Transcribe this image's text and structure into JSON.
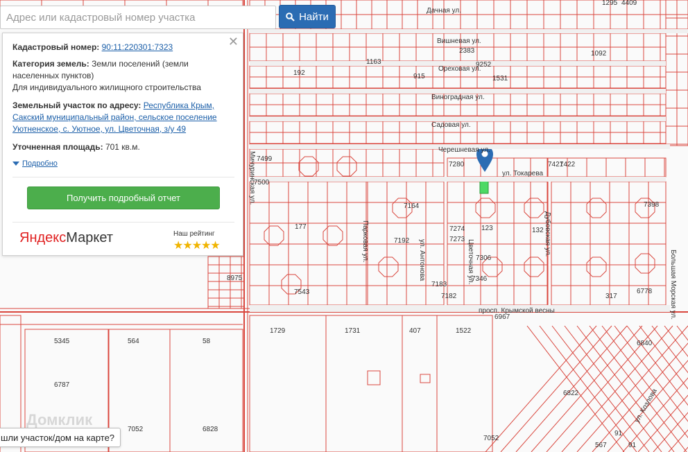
{
  "search": {
    "placeholder": "Адрес или кадастровый номер участка",
    "button_label": "Найти"
  },
  "info": {
    "cadastral_label": "Кадастровый номер:",
    "cadastral_value": "90:11:220301:7323",
    "category_label": "Категория земель:",
    "category_value_1": "Земли поселений (земли",
    "category_value_2": "населенных пунктов)",
    "category_value_3": "Для индивидуального жилищного строительства",
    "address_label": "Земельный участок по адресу:",
    "address_line_1": "Республика Крым,",
    "address_line_2": "Сакский муниципальный район, сельское поселение",
    "address_line_3": "Уютненское, с. Уютное, ул. Цветочная, з/у 49",
    "area_label": "Уточненная площадь:",
    "area_value": "701 кв.м.",
    "more_link": "Подробно",
    "report_button": "Получить подробный отчет",
    "market_brand_1": "Яндекс",
    "market_brand_2": "Маркет",
    "rating_label": "Наш рейтинг",
    "rating_stars": "★★★★★"
  },
  "tooltip": "шли участок/дом на карте?",
  "watermark": "Домклик",
  "map": {
    "colors": {
      "parcel": "#d9463d",
      "road": "#f2f2f2",
      "highlight": "#4cd964",
      "pin": "#2b6cb3"
    },
    "streets": [
      {
        "name": "Дачная ул.",
        "key": "dachnaya"
      },
      {
        "name": "Вишневая ул.",
        "key": "vishnevaya"
      },
      {
        "name": "Ореховая ул.",
        "key": "orehovaya"
      },
      {
        "name": "Виноградная ул.",
        "key": "vinogradnaya"
      },
      {
        "name": "Садовая ул.",
        "key": "sadovaya"
      },
      {
        "name": "Черешневая ул.",
        "key": "chereshnevaya"
      },
      {
        "name": "ул. Токарева",
        "key": "tokareva"
      },
      {
        "name": "Мичуринская ул.",
        "key": "michurinskaya"
      },
      {
        "name": "Парковая ул.",
        "key": "parkovaya"
      },
      {
        "name": "ул. Антонова",
        "key": "antonova"
      },
      {
        "name": "Цветочная ул.",
        "key": "tsvetochnaya"
      },
      {
        "name": "Дубовская ул.",
        "key": "dubovskaya"
      },
      {
        "name": "просп. Крымской весны",
        "key": "krym_vesny"
      },
      {
        "name": "Большая Морская ул.",
        "key": "bolshaya_morskaya"
      },
      {
        "name": "ул. Козлова",
        "key": "kozlova"
      }
    ],
    "parcel_numbers": [
      "1295",
      "4409",
      "1092",
      "1163",
      "2383",
      "9252",
      "915",
      "1531",
      "7499",
      "7500",
      "7280",
      "7421",
      "7422",
      "177",
      "7164",
      "7192",
      "7274",
      "7273",
      "7306",
      "7346",
      "7183",
      "7182",
      "7543",
      "7398",
      "6778",
      "317",
      "6967",
      "8975",
      "1729",
      "1731",
      "407",
      "1522",
      "5345",
      "564",
      "58",
      "6787",
      "7052",
      "6828",
      "6840",
      "6822",
      "7052",
      "91",
      "91",
      "567",
      "123",
      "132",
      "192"
    ]
  }
}
